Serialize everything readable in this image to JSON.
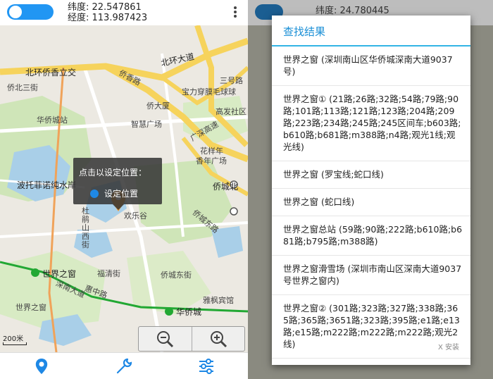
{
  "left": {
    "latitude": "纬度: 22.547861",
    "longitude": "经度: 113.987423",
    "tooltip": {
      "title": "点击以设定位置：",
      "button": "设定位置"
    },
    "scale": "200米",
    "map_labels": {
      "beihuan": "北环侨香立交",
      "qiaobei": "侨北三街",
      "beihuan_ave": "北环大道",
      "qiaoxiang": "侨香路",
      "sanming": "三号路",
      "baoli": "宝力穿膜毛球球",
      "qiaoxiang_garden": "侨大厦",
      "bus_yard": "华侨城站",
      "zhiyin": "智慧广场",
      "guangshen": "广深高速",
      "gaofa": "高发社区",
      "huashu": "花样年",
      "xiangnian": "香年广场",
      "bolotuo": "波托菲诺纯水岸",
      "qiaocheng_north": "侨城北",
      "huanlegu": "欢乐谷",
      "dushan": "杜鹃山西街",
      "fucheng": "福清街",
      "qiaocheng_east": "侨城东街",
      "window": "世界之窗",
      "shennan": "深南大道",
      "qiaocheng_station": "华侨城",
      "window2": "世界之窗",
      "ctbc": "雅枫宾馆",
      "qiao_road": "侨城东路",
      "sheng_road": "惠中路"
    }
  },
  "right": {
    "latitude": "纬度: 24.780445",
    "dialog_title": "查找结果",
    "results": [
      "世界之窗 (深圳南山区华侨城深南大道9037号)",
      "世界之窗① (21路;26路;32路;54路;79路;90路;101路;113路;121路;123路;204路;209路;223路;234路;245路;245区间车;b603路;b610路;b681路;m388路;n4路;观光1线;观光线)",
      "世界之窗 (罗宝线;蛇口线)",
      "世界之窗 (蛇口线)",
      "世界之窗总站 (59路;90路;222路;b610路;b681路;b795路;m388路)",
      "世界之窗滑雪场 (深圳市南山区深南大道9037号世界之窗内)",
      "世界之窗② (301路;323路;327路;338路;365路;365路;3651路;323路;395路;e1路;e13路;e15路;m222路;m222路;m222路;观光2线)"
    ],
    "watermark": "X 安装"
  }
}
